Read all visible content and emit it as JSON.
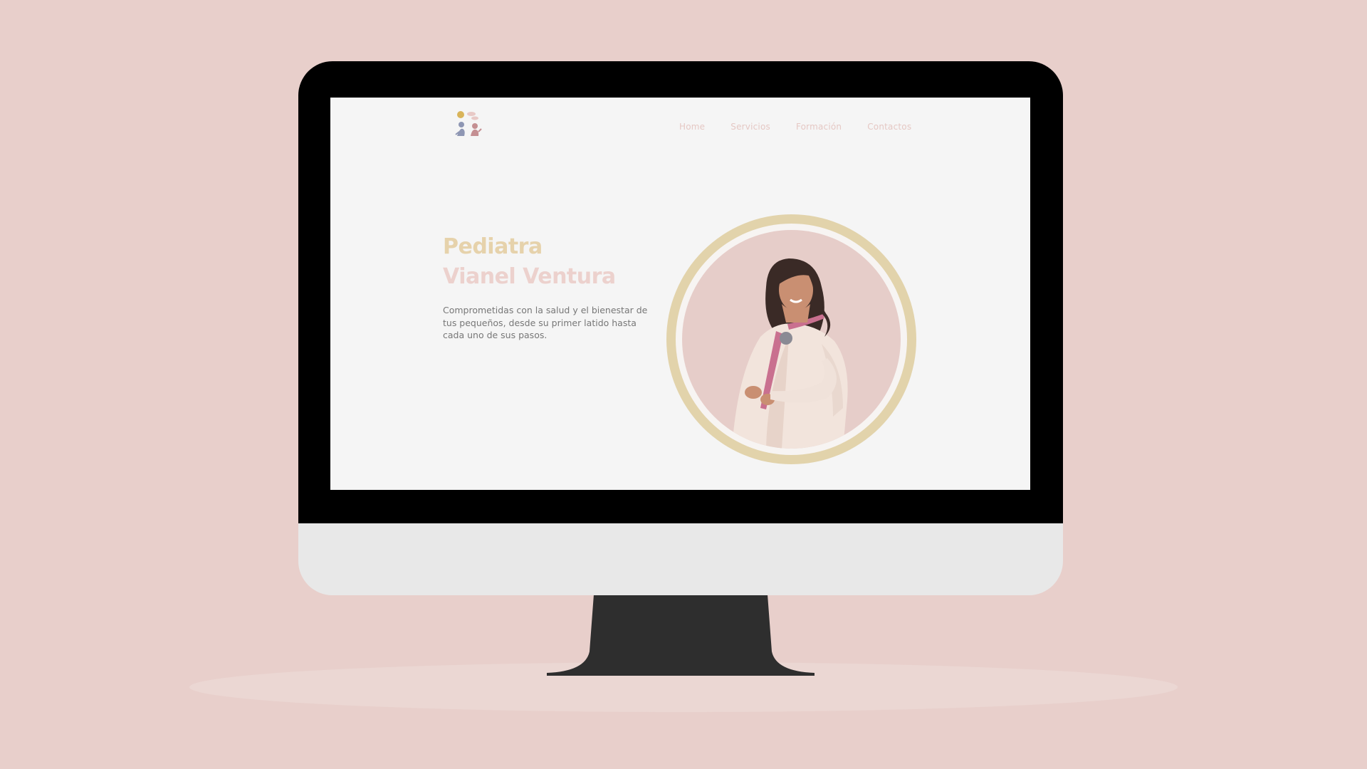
{
  "site": {
    "nav": [
      {
        "label": "Home"
      },
      {
        "label": "Servicios"
      },
      {
        "label": "Formación"
      },
      {
        "label": "Contactos"
      }
    ],
    "logo_icon": "kids-playing-logo-icon"
  },
  "hero": {
    "title_line1": "Pediatra",
    "title_line2": "Vianel Ventura",
    "description": "Comprometidas con la salud y el bienestar de tus pequeños, desde su primer latido hasta cada uno de sus pasos.",
    "portrait_icon": "doctor-portrait-photo"
  },
  "colors": {
    "background": "#e8cfcb",
    "screen": "#f5f5f5",
    "title_gold": "#e6d2ab",
    "title_pink": "#ecd1cd",
    "ring_gold": "#e2d3ab",
    "nav_pink": "#e5c8c4",
    "text_gray": "#777777"
  }
}
